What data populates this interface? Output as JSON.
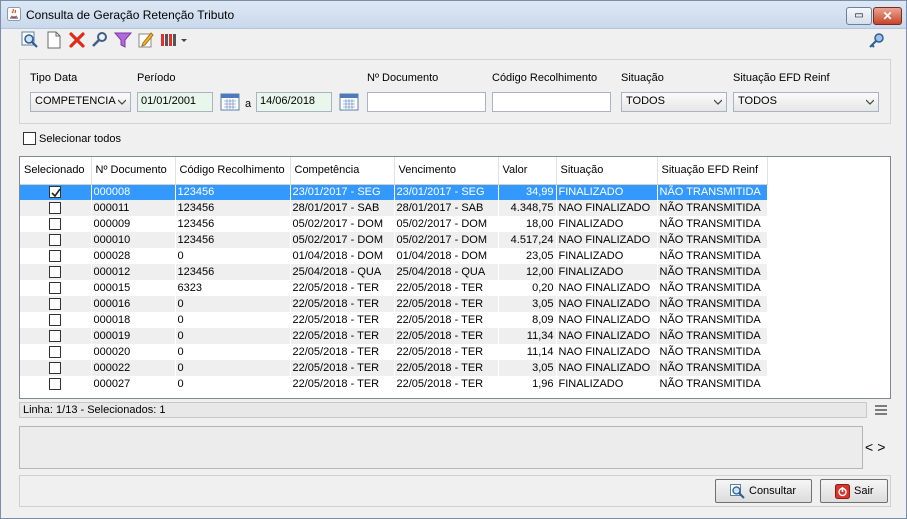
{
  "window": {
    "title": "Consulta de Geração Retenção Tributo",
    "restore_label": "▭",
    "close_label": "✕"
  },
  "toolbar": {
    "icons": [
      "search-icon",
      "new-document-icon",
      "delete-icon",
      "tools-icon",
      "filter-icon",
      "edit-icon",
      "columns-icon",
      "dropdown-arrow-icon"
    ]
  },
  "filters": {
    "tipo_data_label": "Tipo Data",
    "tipo_data_value": "COMPETENCIA",
    "periodo_label": "Período",
    "periodo_de": "01/01/2001",
    "periodo_sep": "a",
    "periodo_ate": "14/06/2018",
    "documento_label": "Nº Documento",
    "documento_value": "",
    "codigo_label": "Código Recolhimento",
    "codigo_value": "",
    "situacao_label": "Situação",
    "situacao_value": "TODOS",
    "efd_label": "Situação EFD Reinf",
    "efd_value": "TODOS"
  },
  "select_all_label": "Selecionar todos",
  "grid": {
    "headers": [
      "Selecionado",
      "Nº Documento",
      "Código Recolhimento",
      "Competência",
      "Vencimento",
      "Valor",
      "Situação",
      "Situação EFD Reinf"
    ],
    "rows": [
      {
        "checked": true,
        "doc": "000008",
        "codigo": "123456",
        "competencia": "23/01/2017 - SEG",
        "vencimento": "23/01/2017 - SEG",
        "valor": "34,99",
        "situacao": "FINALIZADO",
        "efd": "NÃO TRANSMITIDA"
      },
      {
        "checked": false,
        "doc": "000011",
        "codigo": "123456",
        "competencia": "28/01/2017 - SAB",
        "vencimento": "28/01/2017 - SAB",
        "valor": "4.348,75",
        "situacao": "NAO FINALIZADO",
        "efd": "NÃO TRANSMITIDA"
      },
      {
        "checked": false,
        "doc": "000009",
        "codigo": "123456",
        "competencia": "05/02/2017 - DOM",
        "vencimento": "05/02/2017 - DOM",
        "valor": "18,00",
        "situacao": "FINALIZADO",
        "efd": "NÃO TRANSMITIDA"
      },
      {
        "checked": false,
        "doc": "000010",
        "codigo": "123456",
        "competencia": "05/02/2017 - DOM",
        "vencimento": "05/02/2017 - DOM",
        "valor": "4.517,24",
        "situacao": "NAO FINALIZADO",
        "efd": "NÃO TRANSMITIDA"
      },
      {
        "checked": false,
        "doc": "000028",
        "codigo": "0",
        "competencia": "01/04/2018 - DOM",
        "vencimento": "01/04/2018 - DOM",
        "valor": "23,05",
        "situacao": "FINALIZADO",
        "efd": "NÃO TRANSMITIDA"
      },
      {
        "checked": false,
        "doc": "000012",
        "codigo": "123456",
        "competencia": "25/04/2018 - QUA",
        "vencimento": "25/04/2018 - QUA",
        "valor": "12,00",
        "situacao": "FINALIZADO",
        "efd": "NÃO TRANSMITIDA"
      },
      {
        "checked": false,
        "doc": "000015",
        "codigo": "6323",
        "competencia": "22/05/2018 - TER",
        "vencimento": "22/05/2018 - TER",
        "valor": "0,20",
        "situacao": "NAO FINALIZADO",
        "efd": "NÃO TRANSMITIDA"
      },
      {
        "checked": false,
        "doc": "000016",
        "codigo": "0",
        "competencia": "22/05/2018 - TER",
        "vencimento": "22/05/2018 - TER",
        "valor": "3,05",
        "situacao": "NAO FINALIZADO",
        "efd": "NÃO TRANSMITIDA"
      },
      {
        "checked": false,
        "doc": "000018",
        "codigo": "0",
        "competencia": "22/05/2018 - TER",
        "vencimento": "22/05/2018 - TER",
        "valor": "8,09",
        "situacao": "NAO FINALIZADO",
        "efd": "NÃO TRANSMITIDA"
      },
      {
        "checked": false,
        "doc": "000019",
        "codigo": "0",
        "competencia": "22/05/2018 - TER",
        "vencimento": "22/05/2018 - TER",
        "valor": "11,34",
        "situacao": "NAO FINALIZADO",
        "efd": "NÃO TRANSMITIDA"
      },
      {
        "checked": false,
        "doc": "000020",
        "codigo": "0",
        "competencia": "22/05/2018 - TER",
        "vencimento": "22/05/2018 - TER",
        "valor": "11,14",
        "situacao": "NAO FINALIZADO",
        "efd": "NÃO TRANSMITIDA"
      },
      {
        "checked": false,
        "doc": "000022",
        "codigo": "0",
        "competencia": "22/05/2018 - TER",
        "vencimento": "22/05/2018 - TER",
        "valor": "3,05",
        "situacao": "NAO FINALIZADO",
        "efd": "NÃO TRANSMITIDA"
      },
      {
        "checked": false,
        "doc": "000027",
        "codigo": "0",
        "competencia": "22/05/2018 - TER",
        "vencimento": "22/05/2018 - TER",
        "valor": "1,96",
        "situacao": "FINALIZADO",
        "efd": "NÃO TRANSMITIDA"
      }
    ]
  },
  "status": {
    "text": "Linha: 1/13 - Selecionados: 1"
  },
  "nav": {
    "prev": "<",
    "next": ">"
  },
  "buttons": {
    "consultar": "Consultar",
    "sair": "Sair"
  },
  "colors": {
    "selection": "#3399ff",
    "alt_row": "#efefef",
    "date_field": "#e9f6ec"
  }
}
